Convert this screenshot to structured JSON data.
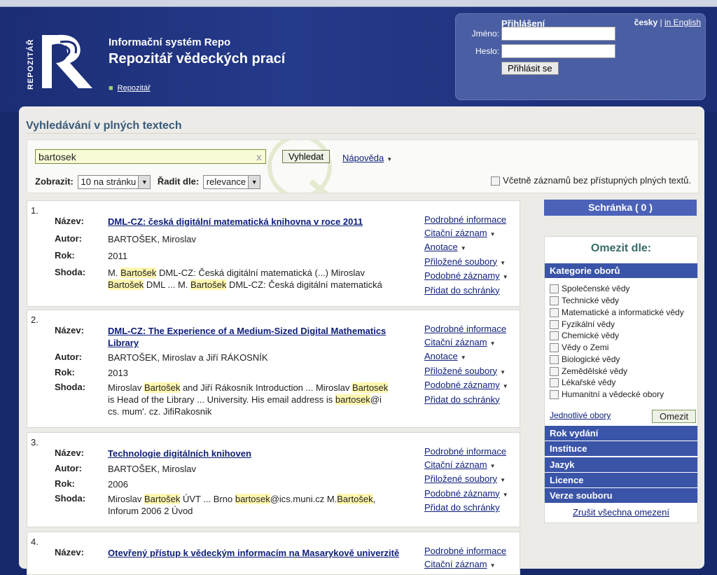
{
  "header": {
    "system_title": "Informační systém Repo",
    "repo_title": "Repozitář vědeckých prací",
    "logo_side_text": "REPOZITÁŘ",
    "breadcrumb": "Repozitář"
  },
  "login": {
    "title": "Přihlášení",
    "lang_cs": "česky",
    "lang_sep": "|",
    "lang_en": "in English",
    "name_label": "Jméno:",
    "password_label": "Heslo:",
    "submit": "Přihlásit se"
  },
  "search": {
    "page_title": "Vyhledávání v plných textech",
    "query": "bartosek",
    "clear": "x",
    "button": "Vyhledat",
    "help": "Nápověda",
    "show_label": "Zobrazit:",
    "show_value": "10 na stránku",
    "sort_label": "Řadit dle:",
    "sort_value": "relevance",
    "include_label": "Včetně záznamů bez přístupných plných textů."
  },
  "labels": {
    "title": "Název:",
    "author": "Autor:",
    "year": "Rok:",
    "match": "Shoda:"
  },
  "actions": {
    "details": "Podrobné informace",
    "citation": "Citační záznam",
    "annotation": "Anotace",
    "files": "Přiložené soubory",
    "similar": "Podobné záznamy",
    "basket_add": "Přidat do schránky"
  },
  "results": [
    {
      "num": "1.",
      "title": "DML-CZ: česká digitální matematická knihovna v roce 2011",
      "author": "BARTOŠEK, Miroslav",
      "year": "2011",
      "match_parts": [
        "M. ",
        "Bartošek",
        " DML-CZ: Česká digitální matematická (...) Miroslav ",
        "Bartošek",
        " DML ... M. ",
        "Bartošek",
        " DML-CZ: Česká digitální matematická"
      ]
    },
    {
      "num": "2.",
      "title": "DML-CZ: The Experience of a Medium-Sized Digital Mathematics Library",
      "author": "BARTOŠEK, Miroslav a Jiří RÁKOSNÍK",
      "year": "2013",
      "match_parts": [
        "Miroslav ",
        "Bartošek",
        " and Jiří Rákosník Introduction ... Miroslav ",
        "Bartosek",
        " is Head of the Library ... University. His email address is ",
        "bartosek",
        "@i cs. mum'. cz. JifiRakosnik"
      ]
    },
    {
      "num": "3.",
      "title": "Technologie digitálních knihoven",
      "author": "BARTOŠEK, Miroslav",
      "year": "2006",
      "match_parts": [
        "Miroslav ",
        "Bartošek",
        " ÚVT ... Brno ",
        "bartosek",
        "@ics.muni.cz M.",
        "Bartošek",
        ", Inforum 2006 2 Úvod"
      ]
    },
    {
      "num": "4.",
      "title": "Otevřený přístup k vědeckým informacím na Masarykově univerzitě"
    }
  ],
  "sidebar": {
    "basket": "Schránka ( 0 )",
    "filter_title": "Omezit dle:",
    "category_header": "Kategorie oborů",
    "categories": [
      "Společenské vědy",
      "Technické vědy",
      "Matematické a informatické vědy",
      "Fyzikální vědy",
      "Chemické vědy",
      "Vědy o Zemi",
      "Biologické vědy",
      "Zemědělské vědy",
      "Lékařské vědy",
      "Humanitní a vědecké obory"
    ],
    "single_fields": "Jednotlivé obory",
    "apply": "Omezit",
    "facets": [
      "Rok vydání",
      "Instituce",
      "Jazyk",
      "Licence",
      "Verze souboru"
    ],
    "cancel_all": "Zrušit všechna omezení"
  }
}
